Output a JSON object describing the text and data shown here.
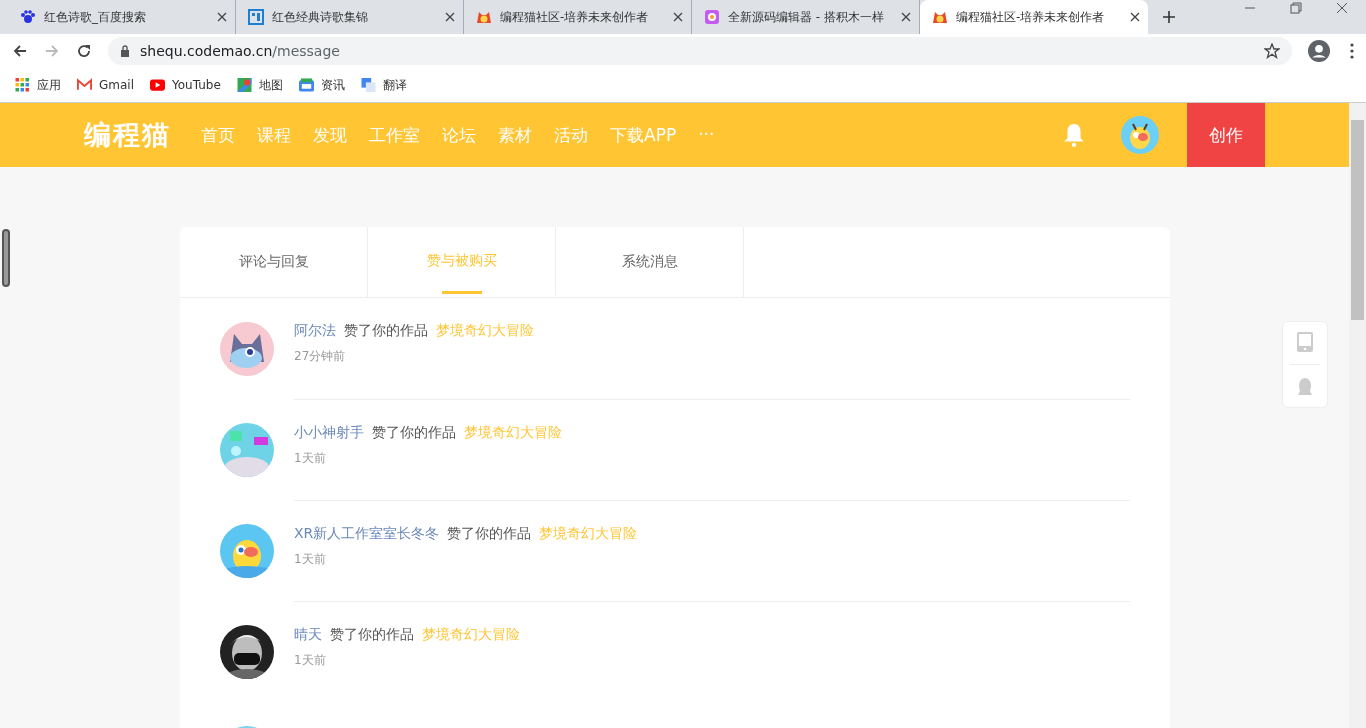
{
  "browser": {
    "tabs": [
      {
        "title": "红色诗歌_百度搜索",
        "selected": false
      },
      {
        "title": "红色经典诗歌集锦",
        "selected": false
      },
      {
        "title": "编程猫社区-培养未来创作者",
        "selected": false
      },
      {
        "title": "全新源码编辑器 - 搭积木一样",
        "selected": false
      },
      {
        "title": "编程猫社区-培养未来创作者",
        "selected": true
      }
    ],
    "url_host": "shequ.codemao.cn",
    "url_path": "/message",
    "bookmarks": [
      {
        "label": "应用"
      },
      {
        "label": "Gmail"
      },
      {
        "label": "YouTube"
      },
      {
        "label": "地图"
      },
      {
        "label": "资讯"
      },
      {
        "label": "翻译"
      }
    ]
  },
  "site": {
    "logo": "编程猫",
    "nav": [
      "首页",
      "课程",
      "发现",
      "工作室",
      "论坛",
      "素材",
      "活动",
      "下载APP",
      "···"
    ],
    "create_button": "创作"
  },
  "message_tabs": [
    {
      "label": "评论与回复",
      "selected": false
    },
    {
      "label": "赞与被购买",
      "selected": true
    },
    {
      "label": "系统消息",
      "selected": false
    }
  ],
  "messages": [
    {
      "user": "阿尔法",
      "action": "赞了你的作品",
      "work": "梦境奇幻大冒险",
      "time": "27分钟前"
    },
    {
      "user": "小小神射手",
      "action": "赞了你的作品",
      "work": "梦境奇幻大冒险",
      "time": "1天前"
    },
    {
      "user": "XR新人工作室室长冬冬",
      "action": "赞了你的作品",
      "work": "梦境奇幻大冒险",
      "time": "1天前"
    },
    {
      "user": "晴天",
      "action": "赞了你的作品",
      "work": "梦境奇幻大冒险",
      "time": "1天前"
    },
    {
      "kind": "picture"
    }
  ]
}
